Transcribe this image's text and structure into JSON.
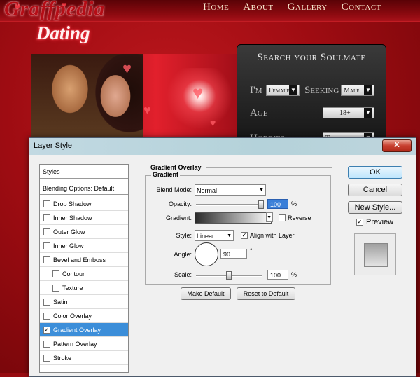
{
  "site": {
    "logo_line1": "Graffpedia",
    "logo_line2": "Dating",
    "nav": [
      "Home",
      "About",
      "Gallery",
      "Contact"
    ]
  },
  "search": {
    "title": "Search your Soulmate",
    "im_label": "I'm",
    "im_value": "Female",
    "seeking_label": "Seeking",
    "seeking_value": "Male",
    "age_label": "Age",
    "age_value": "18+",
    "hobbies_label": "Hobbies",
    "hobbies_value": "Traveling"
  },
  "dialog": {
    "title": "Layer Style",
    "close": "X",
    "styles_header": "Styles",
    "blending_options": "Blending Options: Default",
    "effects": [
      {
        "label": "Drop Shadow",
        "checked": false
      },
      {
        "label": "Inner Shadow",
        "checked": false
      },
      {
        "label": "Outer Glow",
        "checked": false
      },
      {
        "label": "Inner Glow",
        "checked": false
      },
      {
        "label": "Bevel and Emboss",
        "checked": false
      },
      {
        "label": "Contour",
        "checked": false
      },
      {
        "label": "Texture",
        "checked": false
      },
      {
        "label": "Satin",
        "checked": false
      },
      {
        "label": "Color Overlay",
        "checked": false
      },
      {
        "label": "Gradient Overlay",
        "checked": true
      },
      {
        "label": "Pattern Overlay",
        "checked": false
      },
      {
        "label": "Stroke",
        "checked": false
      }
    ],
    "section_title": "Gradient Overlay",
    "group_title": "Gradient",
    "blend_mode_label": "Blend Mode:",
    "blend_mode_value": "Normal",
    "opacity_label": "Opacity:",
    "opacity_value": "100",
    "opacity_level": 1.0,
    "percent": "%",
    "gradient_label": "Gradient:",
    "reverse_label": "Reverse",
    "reverse_checked": false,
    "style_label": "Style:",
    "style_value": "Linear",
    "align_label": "Align with Layer",
    "align_checked": true,
    "angle_label": "Angle:",
    "angle_value": "90",
    "degree": "°",
    "scale_label": "Scale:",
    "scale_value": "100",
    "scale_level": 0.5,
    "make_default": "Make Default",
    "reset_default": "Reset to Default",
    "ok": "OK",
    "cancel": "Cancel",
    "new_style": "New Style...",
    "preview_label": "Preview",
    "preview_checked": true
  },
  "checkmark": "✓",
  "colors": {
    "accent": "#3c8ed9",
    "brand_red": "#b50d16"
  }
}
